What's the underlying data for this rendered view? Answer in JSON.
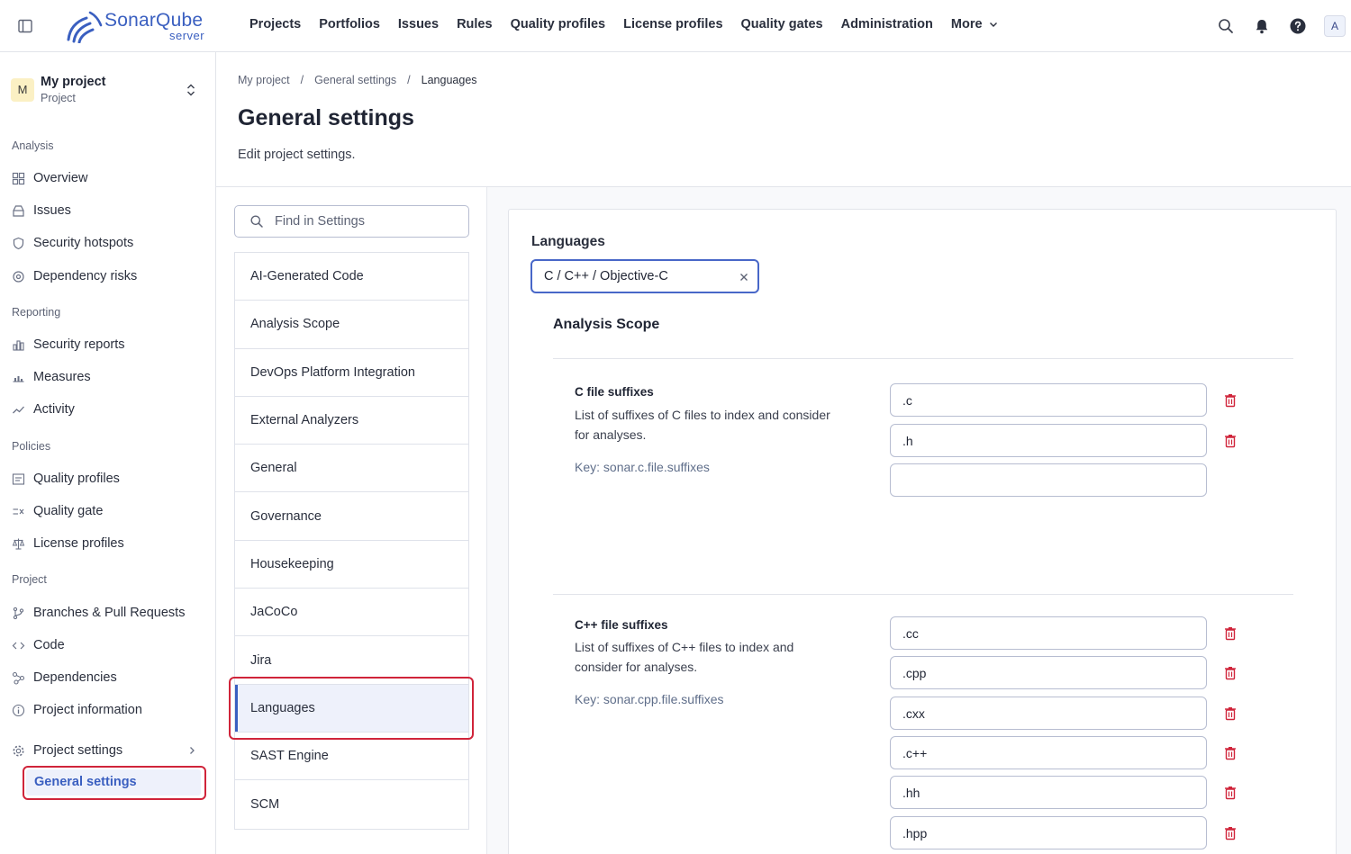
{
  "brand": {
    "name": "SonarQube",
    "edition": "server",
    "color": "#3a5fc0"
  },
  "topnav": {
    "items": [
      "Projects",
      "Portfolios",
      "Issues",
      "Rules",
      "Quality profiles",
      "License profiles",
      "Quality gates",
      "Administration"
    ],
    "more_label": "More",
    "avatar_letter": "A"
  },
  "project": {
    "avatar_letter": "M",
    "name": "My project",
    "type": "Project"
  },
  "sidebar": {
    "sections": {
      "analysis": "Analysis",
      "reporting": "Reporting",
      "policies": "Policies",
      "project": "Project"
    },
    "analysis_items": [
      "Overview",
      "Issues",
      "Security hotspots",
      "Dependency risks"
    ],
    "reporting_items": [
      "Security reports",
      "Measures",
      "Activity"
    ],
    "policies_items": [
      "Quality profiles",
      "Quality gate",
      "License profiles"
    ],
    "project_items": [
      "Branches & Pull Requests",
      "Code",
      "Dependencies",
      "Project information"
    ],
    "project_settings": "Project settings",
    "general_settings": "General settings"
  },
  "breadcrumb": [
    "My project",
    "General settings",
    "Languages"
  ],
  "page": {
    "title": "General settings",
    "subtitle": "Edit project settings."
  },
  "search": {
    "placeholder": "Find in Settings",
    "value": ""
  },
  "categories": [
    "AI-Generated Code",
    "Analysis Scope",
    "DevOps Platform Integration",
    "External Analyzers",
    "General",
    "Governance",
    "Housekeeping",
    "JaCoCo",
    "Jira",
    "Languages",
    "SAST Engine",
    "SCM"
  ],
  "active_category": "Languages",
  "languages": {
    "heading": "Languages",
    "selected": "C / C++ / Objective-C"
  },
  "scope": {
    "title": "Analysis Scope"
  },
  "settings": {
    "c": {
      "name": "C file suffixes",
      "description": "List of suffixes of C files to index and consider for analyses.",
      "key": "Key: sonar.c.file.suffixes",
      "values": [
        ".c",
        ".h",
        ""
      ]
    },
    "cpp": {
      "name": "C++ file suffixes",
      "description": "List of suffixes of C++ files to index and consider for analyses.",
      "key": "Key: sonar.cpp.file.suffixes",
      "values": [
        ".cc",
        ".cpp",
        ".cxx",
        ".c++",
        ".hh",
        ".hpp"
      ]
    }
  },
  "colors": {
    "accent": "#3a5fc0",
    "highlight": "#d0243a",
    "danger": "#d0243a"
  }
}
